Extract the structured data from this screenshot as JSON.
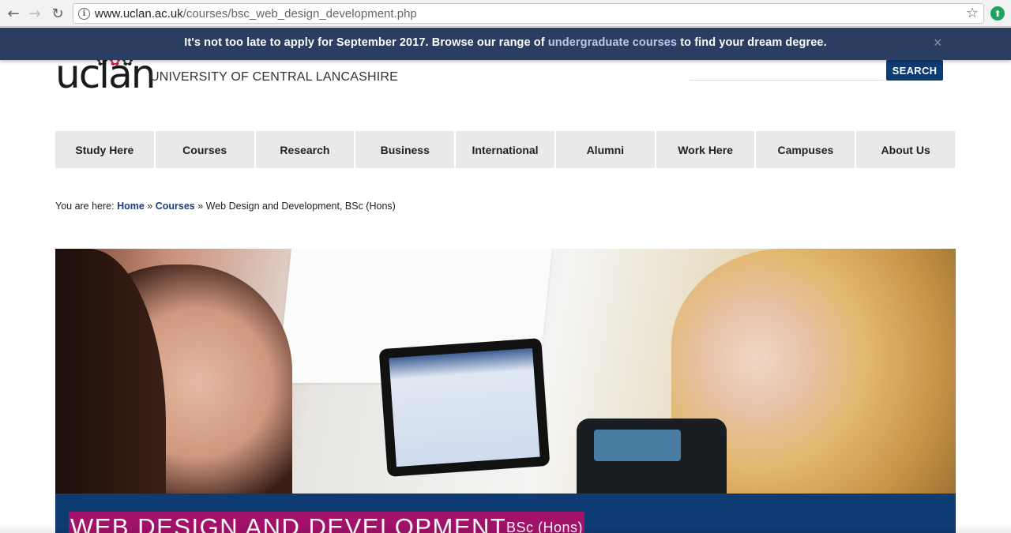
{
  "browser": {
    "url_host": "www.uclan.ac.uk",
    "url_path": "/courses/bsc_web_design_development.php"
  },
  "banner": {
    "text_before": "It's not too late to apply for September 2017. Browse our range of ",
    "link_text": "undergraduate courses",
    "text_after": " to find your dream degree.",
    "close_label": "×"
  },
  "header": {
    "logo_text": "uclan",
    "university_name": "UNIVERSITY OF CENTRAL LANCASHIRE",
    "search_placeholder": "",
    "search_button": "SEARCH"
  },
  "nav": {
    "items": [
      {
        "label": "Study Here"
      },
      {
        "label": "Courses"
      },
      {
        "label": "Research"
      },
      {
        "label": "Business"
      },
      {
        "label": "International"
      },
      {
        "label": "Alumni"
      },
      {
        "label": "Work Here"
      },
      {
        "label": "Campuses"
      },
      {
        "label": "About Us"
      }
    ]
  },
  "breadcrumb": {
    "prefix": "You are here: ",
    "home": "Home",
    "separator": " » ",
    "courses": "Courses",
    "current": "Web Design and Development, BSc (Hons)"
  },
  "course": {
    "title": "WEB DESIGN AND DEVELOPMENT",
    "award": "BSc (Hons)"
  },
  "colors": {
    "banner_bg": "#2b3e62",
    "brand_blue": "#0f3b73",
    "course_highlight": "#a3126a"
  }
}
